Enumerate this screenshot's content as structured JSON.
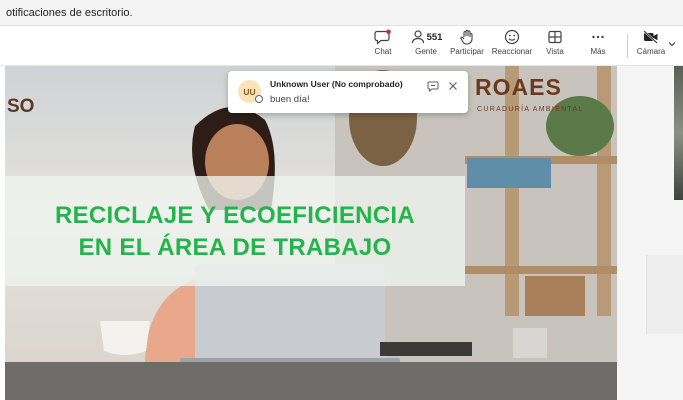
{
  "notification_bar": {
    "text": "otificaciones de escritorio."
  },
  "toolbar": {
    "chat_label": "Chat",
    "people_count": "551",
    "people_label": "Gente",
    "raise_hand_label": "Participar",
    "react_label": "Reaccionar",
    "view_label": "Vista",
    "more_label": "Más",
    "camera_label": "Cámara"
  },
  "slide": {
    "corner_text": "SO",
    "logo_text": "ROAES",
    "logo_subtitle": "CURADURÍA AMBIENTAL",
    "title_line1": "RECICLAJE Y ECOEFICIENCIA",
    "title_line2": "EN EL ÁREA DE TRABAJO",
    "accent_color": "#25b34b"
  },
  "toast": {
    "avatar_initials": "UU",
    "sender": "Unknown User (No comprobado)",
    "message": "buen día!"
  }
}
